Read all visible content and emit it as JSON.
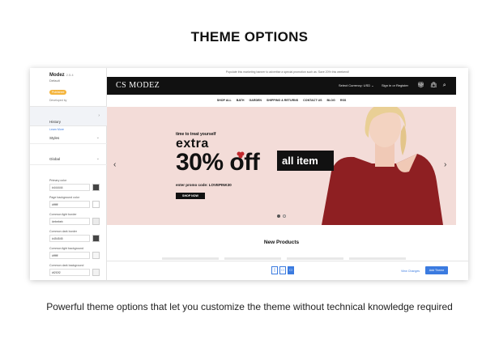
{
  "heading": "THEME OPTIONS",
  "caption": "Powerful theme options that let you customize the theme without technical knowledge required",
  "sidebar": {
    "theme_name": "Modez",
    "version": "2.5.4",
    "default_label": "Default",
    "badge": "Published",
    "developed_by": "Developed by",
    "history": {
      "title": "History",
      "link": "Learn More"
    },
    "styles_label": "Styles",
    "global_label": "Global",
    "fields": [
      {
        "label": "Primary color",
        "value": "#444444",
        "swatch": "#444444"
      },
      {
        "label": "Page background color",
        "value": "#ffffff",
        "swatch": "#ffffff"
      },
      {
        "label": "Common light border",
        "value": "#ebebeb",
        "swatch": "#ebebeb"
      },
      {
        "label": "Common dark border",
        "value": "#454545",
        "swatch": "#454545"
      },
      {
        "label": "Common light background",
        "value": "#ffffff",
        "swatch": "#f6f6f6"
      },
      {
        "label": "Common dark background",
        "value": "#f2f2f2",
        "swatch": "#f2f2f2"
      }
    ]
  },
  "preview": {
    "topbar": "Populate this marketing banner to advertise a special promotion such as: Save 20% this weekend!",
    "logo": "CS MODEZ",
    "currency": "Select Currency: USD ⌄",
    "signin": "Sign in or Register",
    "nav_icons": [
      "gift-icon",
      "bag-icon",
      "search-icon"
    ],
    "menu": [
      "SHOP ALL",
      "BATH",
      "GARDEN",
      "SHIPPING & RETURNS",
      "CONTACT US",
      "BLOG",
      "RSS"
    ],
    "banner": {
      "tagline": "time to treat yourself",
      "extra": "extra",
      "off": "30% off",
      "all_item": "all item",
      "promo": "enter promo code: LOVEPINK30",
      "button": "SHOP NOW",
      "prev": "‹",
      "next": "›",
      "dots": 2,
      "active_dot": 0
    },
    "new_products": "New Products",
    "bottombar": {
      "devices": [
        "mobile-icon",
        "tablet-icon",
        "desktop-icon"
      ],
      "active_device": 2,
      "view_changes": "View Changes",
      "add_theme": "Add Theme"
    }
  },
  "colors": {
    "accent": "#3b7be0",
    "banner_bg": "#f3dcd8",
    "navbar": "#111111",
    "badge": "#f4b43c"
  }
}
